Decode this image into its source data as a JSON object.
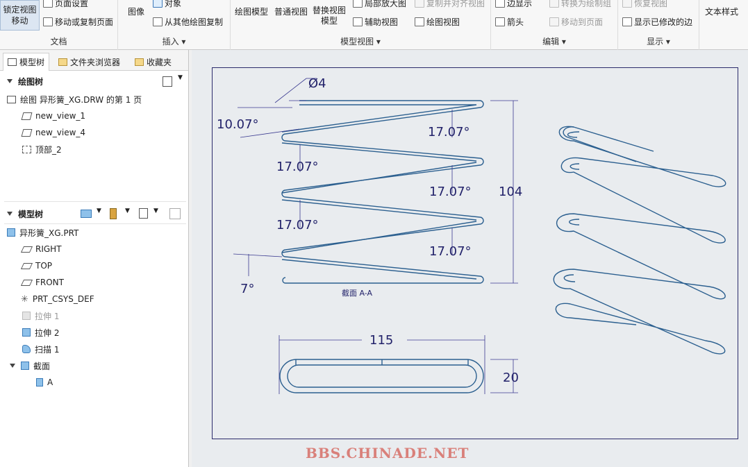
{
  "ribbon": {
    "lock_view_move": "锁定视图\n移动",
    "page_setup": "页面设置",
    "move_copy_page": "移动或复制页面",
    "group_document": "文档",
    "image": "图像",
    "object": "对象",
    "copy_from_other": "从其他绘图复制",
    "group_insert": "插入",
    "drawing_model": "绘图模型",
    "general_view": "普通视图",
    "replace_view_model": "替换视图\n模型",
    "detail_view": "局部放大图",
    "copy_align_view": "复制并对齐视图",
    "auxiliary_view": "辅助视图",
    "drawing_view": "绘图视图",
    "group_model_views": "模型视图",
    "edge_display": "边显示",
    "convert_to_group": "转换为绘制组",
    "arrow": "箭头",
    "move_to_page": "移动到页面",
    "group_edit": "编辑",
    "restore_view": "恢复视图",
    "show_modified_edges": "显示已修改的边",
    "group_display": "显示",
    "text_style": "文本样式"
  },
  "panel": {
    "tabs": [
      "模型树",
      "文件夹浏览器",
      "收藏夹"
    ],
    "drawing_tree_title": "绘图树",
    "drawing_tree_items": [
      "绘图 异形簧_XG.DRW 的第 1 页",
      "new_view_1",
      "new_view_4",
      "顶部_2"
    ],
    "model_tree_title": "模型树",
    "model_tree_items": [
      "异形簧_XG.PRT",
      "RIGHT",
      "TOP",
      "FRONT",
      "PRT_CSYS_DEF",
      "拉伸 1",
      "拉伸 2",
      "扫描 1",
      "截面",
      "A"
    ]
  },
  "drawing": {
    "dims": {
      "diameter": "Ø4",
      "angle_1": "10.07°",
      "angle_2": "17.07°",
      "angle_3": "17.07°",
      "angle_4": "17.07°",
      "angle_5": "17.07°",
      "angle_6": "17.07°",
      "angle_bottom": "7°",
      "height": "104",
      "width": "115",
      "thickness": "20",
      "section_label": "截面  A-A"
    }
  },
  "watermark": "BBS.CHINADE.NET"
}
